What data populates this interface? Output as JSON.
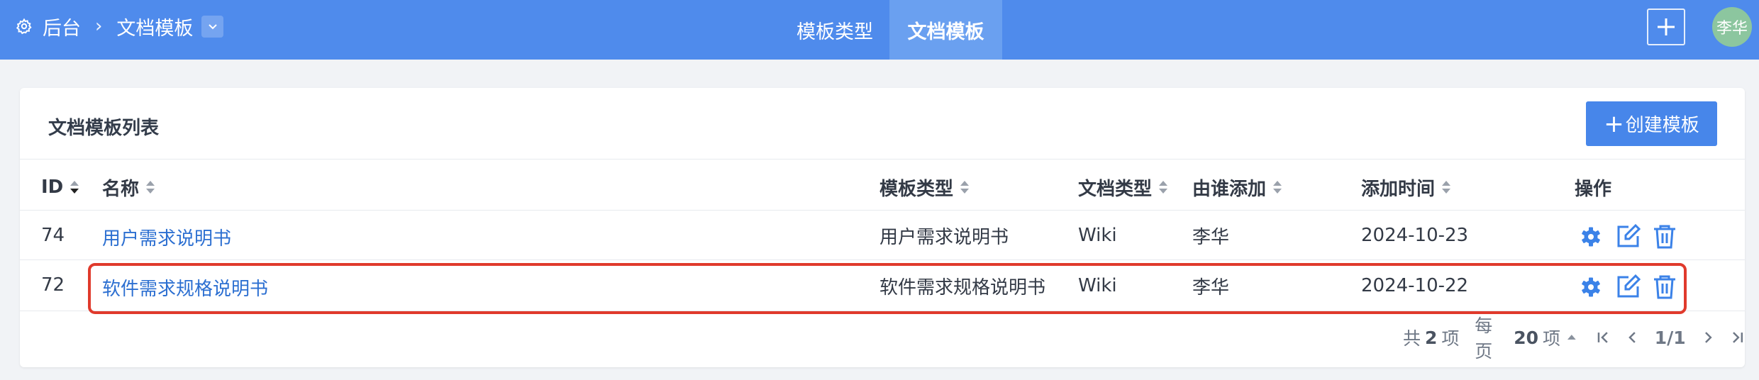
{
  "topbar": {
    "breadcrumb_root": "后台",
    "breadcrumb_current": "文档模板",
    "tabs": [
      {
        "label": "模板类型",
        "active": false
      },
      {
        "label": "文档模板",
        "active": true
      }
    ],
    "avatar_text": "李华"
  },
  "card": {
    "title": "文档模板列表",
    "create_button": "创建模板",
    "columns": {
      "id": "ID",
      "name": "名称",
      "template_type": "模板类型",
      "doc_type": "文档类型",
      "added_by": "由谁添加",
      "added_time": "添加时间",
      "actions": "操作"
    },
    "rows": [
      {
        "id": "74",
        "name": "用户需求说明书",
        "template_type": "用户需求说明书",
        "doc_type": "Wiki",
        "added_by": "李华",
        "added_time": "2024-10-23"
      },
      {
        "id": "72",
        "name": "软件需求规格说明书",
        "template_type": "软件需求规格说明书",
        "doc_type": "Wiki",
        "added_by": "李华",
        "added_time": "2024-10-22"
      }
    ]
  },
  "pagination": {
    "total_prefix": "共",
    "total": "2",
    "total_suffix": "项",
    "per_page_prefix": "每页",
    "per_page": "20",
    "per_page_suffix": "项",
    "page": "1/1"
  },
  "colors": {
    "topbar": "#4f8bec",
    "active_tab": "#6aa0f0",
    "primary_button": "#4786ea",
    "link": "#2c6fd1",
    "highlight": "#e03a2c",
    "avatar": "#8cc69f"
  }
}
